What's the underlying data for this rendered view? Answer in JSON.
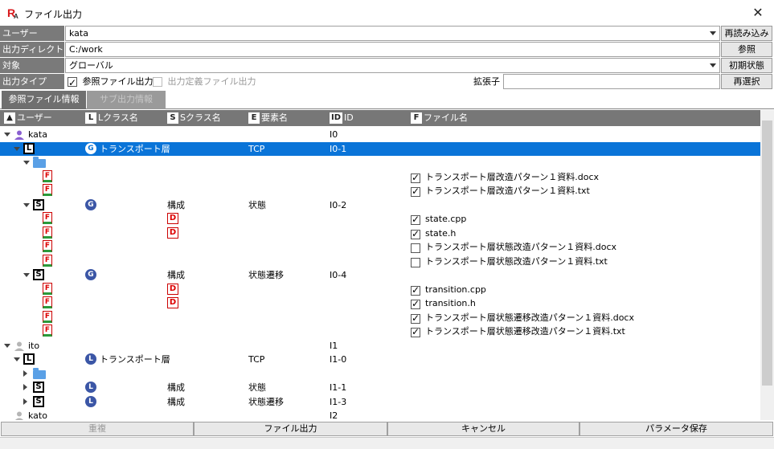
{
  "window": {
    "title": "ファイル出力",
    "close_glyph": "✕"
  },
  "form": {
    "user": {
      "label": "ユーザー",
      "value": "kata"
    },
    "outdir": {
      "label": "出力ディレクトリ",
      "value": "C:/work"
    },
    "target": {
      "label": "対象",
      "value": "グローバル"
    },
    "outtype": {
      "label": "出力タイプ",
      "ref_file_label": "参照ファイル出力",
      "ref_file_checked": true,
      "def_file_label": "出力定義ファイル出力",
      "def_file_checked": false
    },
    "ext": {
      "label": "拡張子",
      "value": ""
    },
    "buttons": {
      "reload": "再読み込み",
      "browse": "参照",
      "init": "初期状態",
      "reselect": "再選択"
    }
  },
  "tabs": [
    {
      "label": "参照ファイル情報",
      "active": true
    },
    {
      "label": "サブ出力情報",
      "active": false
    }
  ],
  "columns": {
    "user": {
      "icon": "▲",
      "label": "ユーザー"
    },
    "lclass": {
      "icon": "L",
      "label": "Lクラス名"
    },
    "sclass": {
      "icon": "S",
      "label": "Sクラス名"
    },
    "element": {
      "icon": "E",
      "label": "要素名"
    },
    "id": {
      "icon": "ID",
      "label": "ID"
    },
    "file": {
      "icon": "F",
      "label": "ファイル名"
    }
  },
  "rows": [
    {
      "indent": 0,
      "exp": "down",
      "icon": "person",
      "icon_color": "#8a5fd1",
      "user": "kata",
      "id": "I0"
    },
    {
      "indent": 1,
      "exp": "down",
      "icon": "L",
      "sel": true,
      "licon": "G",
      "lclass": "トランスポート層",
      "element": "TCP",
      "id": "I0-1"
    },
    {
      "indent": 2,
      "exp": "down",
      "icon": "folder"
    },
    {
      "indent": 3,
      "icon": "F",
      "file": "トランスポート層改造パターン１資料.docx",
      "checked": true
    },
    {
      "indent": 3,
      "icon": "F",
      "file": "トランスポート層改造パターン１資料.txt",
      "checked": true
    },
    {
      "indent": 2,
      "exp": "down",
      "icon": "S",
      "licon": "G",
      "sclass": "構成",
      "element": "状態",
      "id": "I0-2"
    },
    {
      "indent": 3,
      "icon": "F",
      "sicon": "D",
      "file": "state.cpp",
      "checked": true
    },
    {
      "indent": 3,
      "icon": "F",
      "sicon": "D",
      "file": "state.h",
      "checked": true
    },
    {
      "indent": 3,
      "icon": "F",
      "file": "トランスポート層状態改造パターン１資料.docx",
      "checked": false
    },
    {
      "indent": 3,
      "icon": "F",
      "file": "トランスポート層状態改造パターン１資料.txt",
      "checked": false
    },
    {
      "indent": 2,
      "exp": "down",
      "icon": "S",
      "licon": "G",
      "sclass": "構成",
      "element": "状態遷移",
      "id": "I0-4"
    },
    {
      "indent": 3,
      "icon": "F",
      "sicon": "D",
      "file": "transition.cpp",
      "checked": true
    },
    {
      "indent": 3,
      "icon": "F",
      "sicon": "D",
      "file": "transition.h",
      "checked": true
    },
    {
      "indent": 3,
      "icon": "F",
      "file": "トランスポート層状態遷移改造パターン１資料.docx",
      "checked": true
    },
    {
      "indent": 3,
      "icon": "F",
      "file": "トランスポート層状態遷移改造パターン１資料.txt",
      "checked": true
    },
    {
      "indent": 0,
      "exp": "down",
      "icon": "person",
      "icon_color": "#b5b5b5",
      "user": "ito",
      "id": "I1"
    },
    {
      "indent": 1,
      "exp": "down",
      "icon": "L",
      "licon": "L",
      "lclass": "トランスポート層",
      "element": "TCP",
      "id": "I1-0"
    },
    {
      "indent": 2,
      "exp": "right",
      "icon": "folder"
    },
    {
      "indent": 2,
      "exp": "right",
      "icon": "S",
      "licon": "L",
      "sclass": "構成",
      "element": "状態",
      "id": "I1-1"
    },
    {
      "indent": 2,
      "exp": "right",
      "icon": "S",
      "licon": "L",
      "sclass": "構成",
      "element": "状態遷移",
      "id": "I1-3"
    },
    {
      "indent": 0,
      "icon": "person",
      "icon_color": "#b5b5b5",
      "user": "kato",
      "id": "I2"
    }
  ],
  "bottom_buttons": {
    "duplicate": "重複",
    "export": "ファイル出力",
    "cancel": "キャンセル",
    "save_params": "パラメータ保存"
  },
  "colors": {
    "selection": "#0a74d8",
    "header": "#777777",
    "label_bg": "#7a7a7a"
  }
}
